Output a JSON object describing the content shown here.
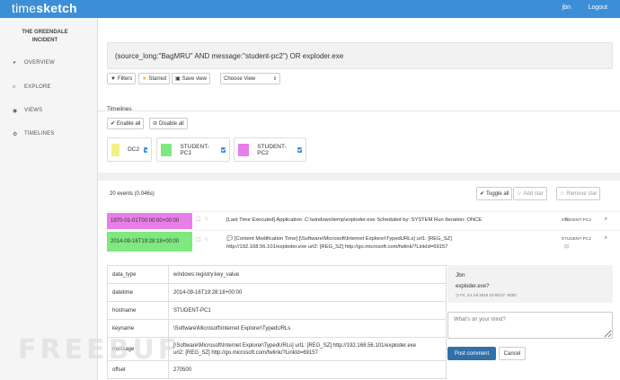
{
  "app": {
    "logo_prefix": "time",
    "logo_suffix": "sketch",
    "user": "jbn",
    "logout": "Logout"
  },
  "sidebar": {
    "title_line1": "THE GREENDALE",
    "title_line2": "INCIDENT",
    "items": [
      {
        "label": "OVERVIEW",
        "icon": "pie-chart-icon"
      },
      {
        "label": "EXPLORE",
        "icon": "search-icon"
      },
      {
        "label": "VIEWS",
        "icon": "eye-icon"
      },
      {
        "label": "TIMELINES",
        "icon": "settings-icon"
      }
    ]
  },
  "query": {
    "text": "(source_long:\"BagMRU\" AND message:\"student-pc2\") OR exploder.exe"
  },
  "toolbar": {
    "filters": "Filters",
    "starred": "Starred",
    "save_view": "Save view",
    "choose_view": "Choose View"
  },
  "timelines": {
    "heading": "Timelines",
    "enable_all": "Enable all",
    "disable_all": "Disable all",
    "items": [
      {
        "name": "DC2",
        "color": "#f1f285"
      },
      {
        "name": "STUDENT-PC1",
        "color": "#7fe87f"
      },
      {
        "name": "STUDENT-PC2",
        "color": "#e87fe8"
      }
    ]
  },
  "events": {
    "count": "20 events (0.046s)",
    "toggle_all": "Toggle all",
    "add_star": "Add star",
    "remove_star": "Remove star",
    "rows": [
      {
        "datetime": "1970-01-01T00:00:00+00:00",
        "color": "#e87fe8",
        "message_line1": "[Last Time Executed] Application: C:\\windows\\temp\\exploder.exe Scheduled by: SYSTEM Run Iteration: ONCE",
        "message_line2": "",
        "source": "STUDENT-PC2"
      },
      {
        "datetime": "2014-09-16T19:28:18+00:00",
        "color": "#7fe87f",
        "message_line1": "[Content Modification Time] [\\Software\\Microsoft\\Internet Explorer\\TypedURLs] url1: [REG_SZ]",
        "message_line2": "http://192.168.56.101/exploder.exe url2: [REG_SZ] http://go.microsoft.com/fwlink/?LinkId=69157",
        "source": "STUDENT-PC1"
      }
    ]
  },
  "details": [
    {
      "key": "data_type",
      "value": "windows:registry:key_value",
      "value2": ""
    },
    {
      "key": "datetime",
      "value": "2014-09-16T19:28:18+00:00",
      "value2": ""
    },
    {
      "key": "hostname",
      "value": "STUDENT-PC1",
      "value2": ""
    },
    {
      "key": "keyname",
      "value": "\\Software\\Microsoft\\Internet Explorer\\TypedURLs",
      "value2": ""
    },
    {
      "key": "message",
      "value": "[\\Software\\Microsoft\\Internet Explorer\\TypedURLs] url1: [REG_SZ] http://192.168.56.101/exploder.exe",
      "value2": "url2: [REG_SZ] http://go.microsoft.com/fwlink/?LinkId=69157"
    },
    {
      "key": "offset",
      "value": "270500",
      "value2": ""
    }
  ],
  "comment": {
    "user": "Jbn",
    "text": "exploder.exe?",
    "date": "Fri, 24 Jul 2015 10:59:37 -0000",
    "placeholder": "What's on your mind?",
    "post": "Post comment",
    "cancel": "Cancel"
  },
  "watermark": "FREEBUF"
}
